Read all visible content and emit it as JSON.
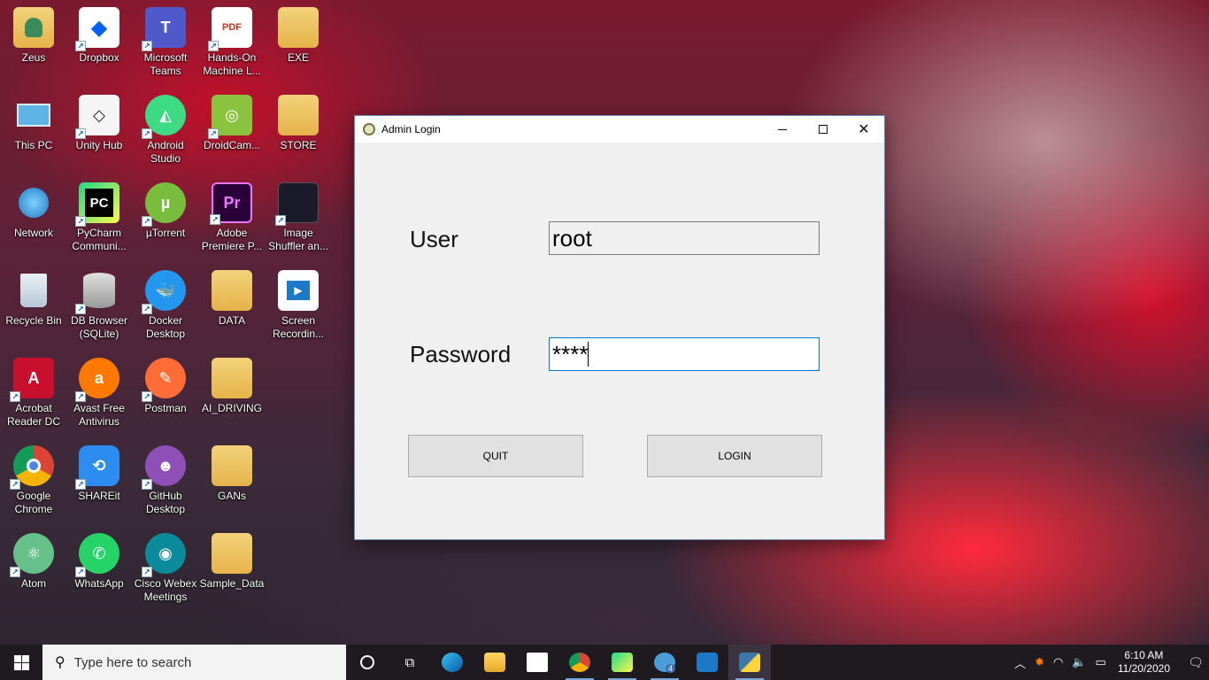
{
  "desktop": {
    "icons": [
      {
        "label": "Zeus"
      },
      {
        "label": "Dropbox"
      },
      {
        "label": "Microsoft Teams"
      },
      {
        "label": "Hands-On Machine L..."
      },
      {
        "label": "EXE"
      },
      {
        "label": "This PC"
      },
      {
        "label": "Unity Hub"
      },
      {
        "label": "Android Studio"
      },
      {
        "label": "DroidCam..."
      },
      {
        "label": "STORE"
      },
      {
        "label": "Network"
      },
      {
        "label": "PyCharm Communi..."
      },
      {
        "label": "µTorrent"
      },
      {
        "label": "Adobe Premiere P..."
      },
      {
        "label": "Image Shuffler an..."
      },
      {
        "label": "Recycle Bin"
      },
      {
        "label": "DB Browser (SQLite)"
      },
      {
        "label": "Docker Desktop"
      },
      {
        "label": "DATA"
      },
      {
        "label": "Screen Recordin..."
      },
      {
        "label": "Acrobat Reader DC"
      },
      {
        "label": "Avast Free Antivirus"
      },
      {
        "label": "Postman"
      },
      {
        "label": "AI_DRIVING"
      },
      {
        "label": "Google Chrome"
      },
      {
        "label": "SHAREit"
      },
      {
        "label": "GitHub Desktop"
      },
      {
        "label": "GANs"
      },
      {
        "label": "Atom"
      },
      {
        "label": "WhatsApp"
      },
      {
        "label": "Cisco Webex Meetings"
      },
      {
        "label": "Sample_Data"
      }
    ]
  },
  "window": {
    "title": "Admin Login",
    "user_label": "User",
    "user_value": "root",
    "password_label": "Password",
    "password_value": "****",
    "quit_label": "QUIT",
    "login_label": "LOGIN"
  },
  "taskbar": {
    "search_placeholder": "Type here to search",
    "telegram_badge": "4",
    "time": "6:10 AM",
    "date": "11/20/2020"
  },
  "colors": {
    "accent": "#0078d7",
    "taskbar": "#1f1a20",
    "window_bg": "#f0f0f0"
  }
}
